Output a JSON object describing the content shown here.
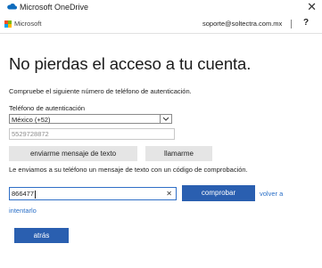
{
  "window": {
    "title": "Microsoft OneDrive",
    "close_glyph": "✕"
  },
  "header": {
    "brand": "Microsoft",
    "account": "soporte@soltectra.com.mx",
    "help_glyph": "?"
  },
  "page": {
    "heading": "No pierdas el acceso a tu cuenta.",
    "instruction": "Compruebe el siguiente número de teléfono de autenticación.",
    "phone_label": "Teléfono de autenticación",
    "country_select": "México (+52)",
    "phone_placeholder": "5529728872",
    "text_button": "enviarme mensaje de texto",
    "call_button": "llamarme",
    "sent_message": "Le enviamos a su teléfono un mensaje de texto con un código de comprobación.",
    "code_value": "866477",
    "clear_glyph": "✕",
    "verify_button": "comprobar",
    "retry_link_1": "volver a",
    "retry_link_2": "intentarlo",
    "back_button": "atrás"
  },
  "colors": {
    "accent": "#2a5fb0",
    "link": "#2a6fc7",
    "onedrive": "#0f6cbd"
  },
  "icons": [
    "onedrive-cloud-icon",
    "microsoft-logo-icon",
    "close-icon",
    "help-icon",
    "chevron-down-icon",
    "clear-icon"
  ]
}
